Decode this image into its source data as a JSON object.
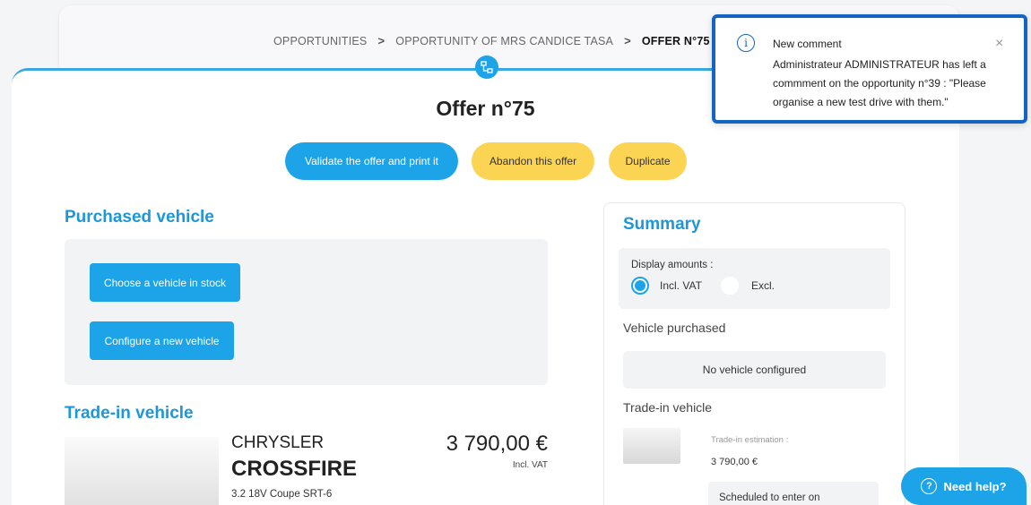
{
  "breadcrumb": {
    "items": [
      "OPPORTUNITIES",
      "OPPORTUNITY OF MRS CANDICE TASA",
      "OFFER N°75"
    ],
    "separator": ">"
  },
  "page": {
    "title": "Offer n°75"
  },
  "actions": {
    "validate": "Validate the offer and print it",
    "abandon": "Abandon this offer",
    "duplicate": "Duplicate"
  },
  "purchased": {
    "title": "Purchased vehicle",
    "choose_stock": "Choose a vehicle in stock",
    "configure_new": "Configure a new vehicle"
  },
  "tradein": {
    "title": "Trade-in vehicle",
    "make": "CHRYSLER",
    "model": "CROSSFIRE",
    "description": "3.2 18V Coupe SRT-6",
    "price": "3 790,00 €",
    "price_note": "Incl. VAT"
  },
  "summary": {
    "title": "Summary",
    "display_amounts_label": "Display amounts :",
    "incl_vat": "Incl. VAT",
    "excl": "Excl.",
    "selected": "incl",
    "vehicle_purchased_label": "Vehicle purchased",
    "no_vehicle": "No vehicle configured",
    "tradein_label": "Trade-in vehicle",
    "tradein_estimation_label": "Trade-in estimation :",
    "tradein_estimation_value": "3 790,00 €",
    "scheduled_label": "Scheduled to enter on"
  },
  "help": {
    "label": "Need help?"
  },
  "notification": {
    "title": "New comment",
    "body": "Administrateur ADMINISTRATEUR has left a commment on the opportunity n°39 : \"Please organise a new test drive with them.\"",
    "close": "×"
  },
  "colors": {
    "accent": "#1ca3e8",
    "secondary": "#fcd453",
    "notification_border": "#1565c0",
    "section_title": "#1e96d8"
  }
}
